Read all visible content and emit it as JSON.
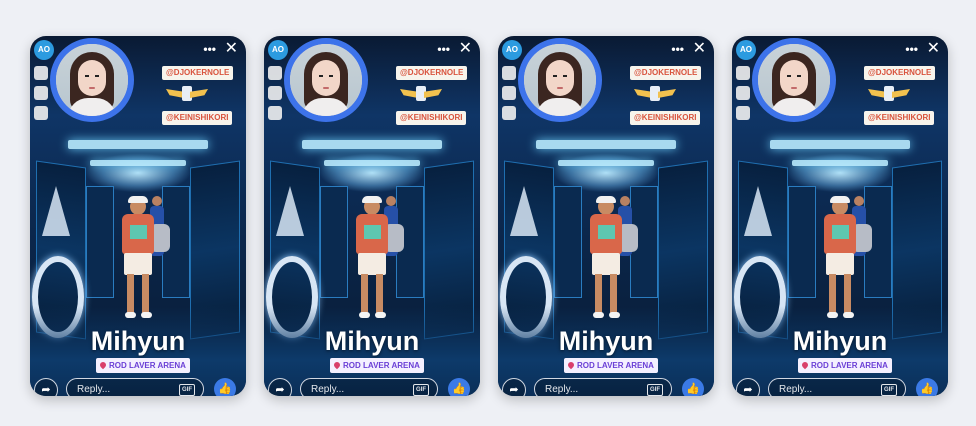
{
  "stories": [
    {
      "name": "Mihyun",
      "location": "ROD LAVER ARENA",
      "reply_placeholder": "Reply...",
      "stickers": [
        "@DJOKERNOLE",
        "@KEINISHIKORI"
      ],
      "brand": "AO"
    },
    {
      "name": "Mihyun",
      "location": "ROD LAVER ARENA",
      "reply_placeholder": "Reply...",
      "stickers": [
        "@DJOKERNOLE",
        "@KEINISHIKORI"
      ],
      "brand": "AO"
    },
    {
      "name": "Mihyun",
      "location": "ROD LAVER ARENA",
      "reply_placeholder": "Reply...",
      "stickers": [
        "@DJOKERNOLE",
        "@KEINISHIKORI"
      ],
      "brand": "AO"
    },
    {
      "name": "Mihyun",
      "location": "ROD LAVER ARENA",
      "reply_placeholder": "Reply...",
      "stickers": [
        "@DJOKERNOLE",
        "@KEINISHIKORI"
      ],
      "brand": "AO"
    }
  ],
  "icons": {
    "more": "more-horizontal-icon",
    "close": "close-icon",
    "share": "share-icon",
    "like": "thumbs-up-icon",
    "gif": "gif-icon",
    "location": "location-pin-icon"
  },
  "colors": {
    "avatar_ring": "#3d73ea",
    "like_button": "#3b7ae6",
    "background": "#eef0f5"
  }
}
